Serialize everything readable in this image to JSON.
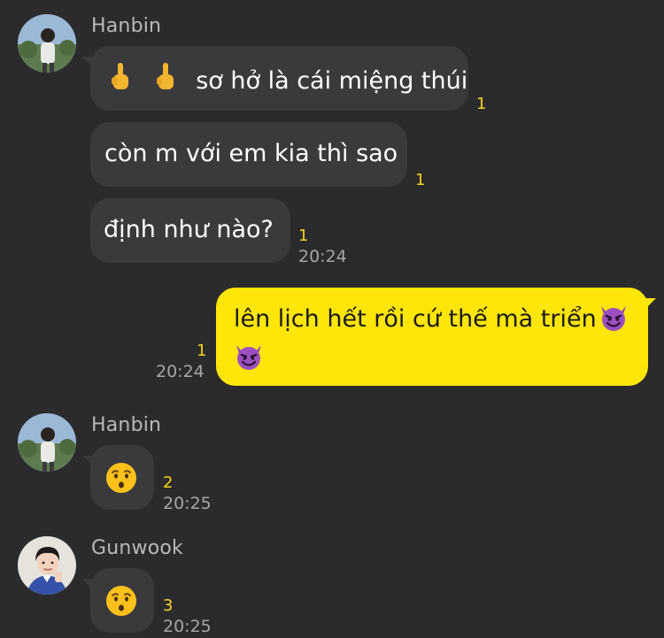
{
  "messages": [
    {
      "sender": "Hanbin",
      "text": "sơ hở là cái miệng thúi",
      "prefix_icons": [
        "middle-finger-icon",
        "middle-finger-icon"
      ],
      "unread": "1"
    },
    {
      "text": "còn m với em kia thì sao",
      "unread": "1"
    },
    {
      "text": "định như nào?",
      "unread": "1",
      "time": "20:24"
    },
    {
      "text": "lên lịch hết rồi cứ thế mà triển",
      "suffix_icons": [
        "smiling-devil-icon",
        "smiling-devil-icon"
      ],
      "unread": "1",
      "time": "20:24",
      "mine": true
    },
    {
      "sender": "Hanbin",
      "emoji": "hushed-face-icon",
      "unread": "2",
      "time": "20:25"
    },
    {
      "sender": "Gunwook",
      "emoji": "hushed-face-icon",
      "unread": "3",
      "time": "20:25"
    }
  ],
  "colors": {
    "background": "#2b2b2d",
    "incoming_bubble": "#3a3a3d",
    "outgoing_bubble": "#fee50a",
    "unread_count": "#f7d31b",
    "timestamp": "#a6a6aa",
    "sender_name": "#b9b9bd"
  }
}
